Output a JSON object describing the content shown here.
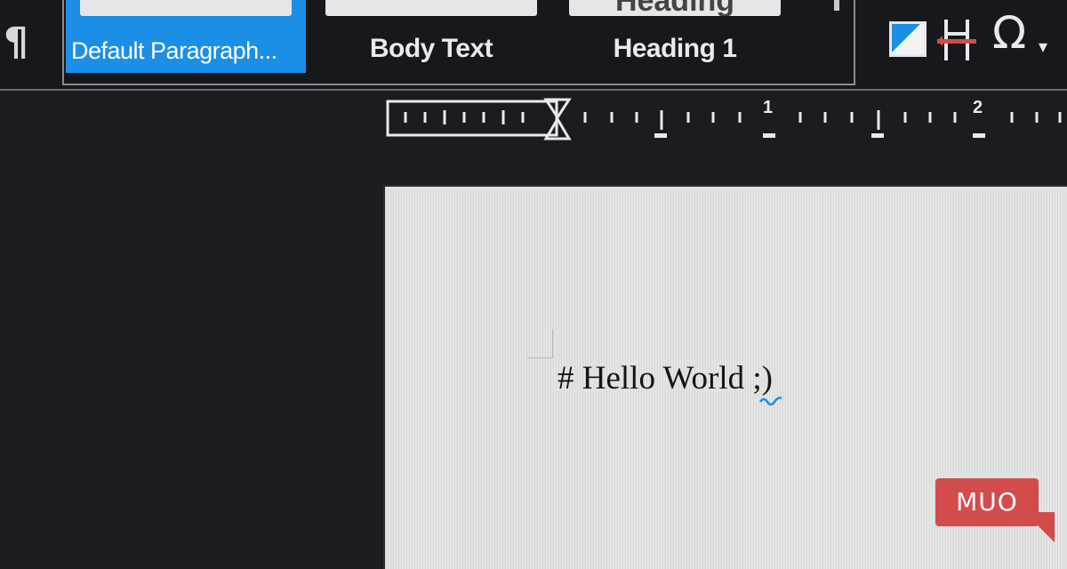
{
  "ribbon": {
    "paragraph_mark": "¶",
    "styles": [
      {
        "label": "Default Paragraph...",
        "preview": "",
        "selected": true
      },
      {
        "label": "Body Text",
        "preview": "",
        "selected": false
      },
      {
        "label": "Heading 1",
        "preview": "Heading",
        "selected": false
      }
    ],
    "insert_tools": {
      "image_icon": "image-icon",
      "page_break_icon": "page-break-icon",
      "special_character": "Ω",
      "dropdown_chevron": "▾"
    }
  },
  "ruler": {
    "labels": [
      "1",
      "2"
    ]
  },
  "document": {
    "text": "# Hello World ;)"
  },
  "watermark": {
    "text": "MUO"
  },
  "colors": {
    "accent": "#1b8fe6",
    "page": "#e4e6e4",
    "background": "#1b1c20",
    "logo": "#d24c4c"
  }
}
